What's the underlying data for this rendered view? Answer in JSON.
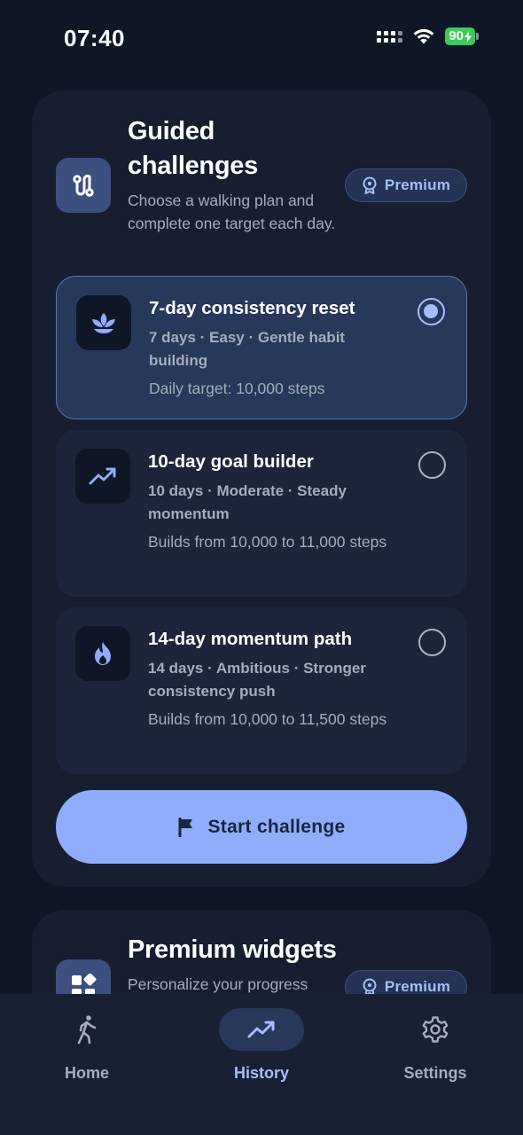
{
  "status_bar": {
    "time": "07:40",
    "battery": "90",
    "icons": [
      "signal-icon",
      "wifi-icon",
      "battery-charging-icon"
    ]
  },
  "guided": {
    "title": "Guided challenges",
    "description": "Choose a walking plan and complete one target each day.",
    "badge": "Premium",
    "icon": "route-icon",
    "badge_icon": "award-icon",
    "options": [
      {
        "title": "7-day consistency reset",
        "meta": "7 days · Easy · Gentle habit building",
        "target": "Daily target: 10,000 steps",
        "icon": "lotus-icon",
        "selected": true
      },
      {
        "title": "10-day goal builder",
        "meta": "10 days · Moderate · Steady momentum",
        "target": "Builds from 10,000 to 11,000 steps",
        "icon": "trending-up-icon",
        "selected": false
      },
      {
        "title": "14-day momentum path",
        "meta": "14 days · Ambitious · Stronger consistency push",
        "target": "Builds from 10,000 to 11,500 steps",
        "icon": "flame-icon",
        "selected": false
      }
    ],
    "start_button": "Start challenge",
    "start_icon": "flag-icon"
  },
  "widgets": {
    "title": "Premium widgets",
    "description": "Personalize your progress",
    "badge": "Premium",
    "icon": "widgets-icon"
  },
  "nav": {
    "items": [
      {
        "label": "Home",
        "icon": "walking-icon",
        "active": false
      },
      {
        "label": "History",
        "icon": "trending-up-icon",
        "active": true
      },
      {
        "label": "Settings",
        "icon": "gear-icon",
        "active": false
      }
    ]
  },
  "colors": {
    "background": "#0f1626",
    "card": "#161e30",
    "accent": "#8fadfb",
    "accent_text": "#a5bdfc",
    "battery": "#3ccb5a"
  }
}
